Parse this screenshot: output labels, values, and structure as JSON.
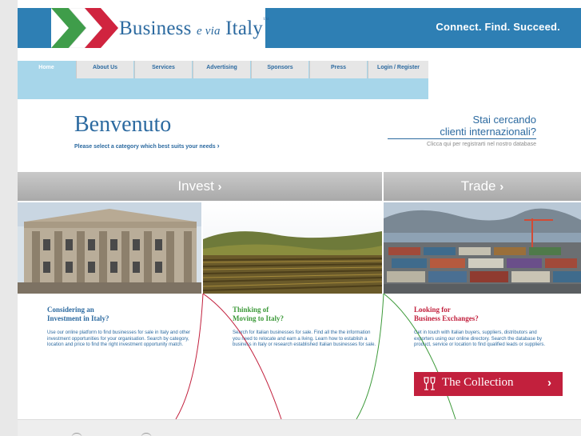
{
  "header": {
    "brand_main": "Business",
    "brand_evia": "e via",
    "brand_end": "Italy",
    "brand_tm": "™",
    "tagline": "Connect. Find. Succeed."
  },
  "nav": {
    "items": [
      {
        "label": "Home"
      },
      {
        "label": "About Us"
      },
      {
        "label": "Services"
      },
      {
        "label": "Advertising"
      },
      {
        "label": "Sponsors"
      },
      {
        "label": "Press"
      },
      {
        "label": "Login / Register"
      }
    ],
    "active_index": 0
  },
  "welcome": {
    "title": "Benvenuto",
    "subtitle": "Please select a category which best suits your needs",
    "chevron": "›"
  },
  "cta": {
    "line1": "Stai cercando",
    "line2": "clienti internazionali?",
    "subtext": "Clicca qui per registrarti nel nostro database"
  },
  "bands": {
    "invest": "Invest",
    "trade": "Trade",
    "chevron": "›"
  },
  "panels": [
    {
      "title_line1": "Considering an",
      "title_line2": "Investment in Italy?",
      "body": "Use our online platform to find businesses for sale in Italy and other investment opportunities for your organisation. Search by category, location and price to find the right investment opportunity match.",
      "color": "#2c6aa0"
    },
    {
      "title_line1": "Thinking of",
      "title_line2": "Moving to Italy?",
      "body": "Search for Italian businesses for sale. Find all the the information you need to relocate and earn a living. Learn how to establish a business in Italy or research established Italian businesses for sale.",
      "color": "#3d9a3a"
    },
    {
      "title_line1": "Looking for",
      "title_line2": "Business Exchanges?",
      "body": "Get in touch with Italian buyers, suppliers, distributors and exporters using our online directory. Search the database by product, service or location to find qualified leads or suppliers.",
      "color": "#c2203d"
    }
  ],
  "collection_button": {
    "label": "The Collection",
    "icon": "wine-glasses-icon",
    "arrow": "›"
  },
  "colors": {
    "brand_blue": "#2e7fb4",
    "nav_light_blue": "#a7d6ea",
    "invest_green": "#3d9a3a",
    "trade_red": "#c2203d"
  }
}
